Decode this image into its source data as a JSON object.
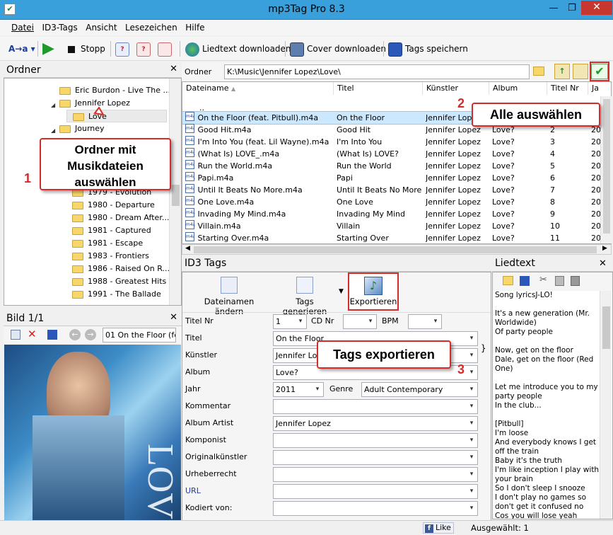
{
  "window": {
    "title": "mp3Tag Pro 8.3",
    "min": "—",
    "max": "❐",
    "close": "✕"
  },
  "menu": [
    "Datei",
    "ID3-Tags",
    "Ansicht",
    "Lesezeichen",
    "Hilfe"
  ],
  "toolbar": {
    "case_label": "A→a",
    "stop_label": "Stopp",
    "lyrics_label": "Liedtext downloaden",
    "cover_label": "Cover downloaden",
    "save_label": "Tags speichern"
  },
  "folder_panel": {
    "title": "Ordner",
    "close": "✕",
    "items": [
      "Eric Burdon - Live The ...",
      "Jennifer Lopez",
      "Love",
      "Journey",
      "1979 - Evolution",
      "1980 - Departure",
      "1980 - Dream After...",
      "1981 - Captured",
      "1981 - Escape",
      "1983 - Frontiers",
      "1986 - Raised On R...",
      "1988 - Greatest Hits",
      "1991 - The Ballade"
    ]
  },
  "image_panel": {
    "title": "Bild 1/1",
    "close": "✕",
    "filename": "01 On the Floor (fea",
    "cover_text": "LOVE?"
  },
  "file_panel": {
    "path_label": "Ordner",
    "path_value": "K:\\Music\\Jennifer Lopez\\Love\\",
    "columns": [
      "Dateiname",
      "Titel",
      "Künstler",
      "Album",
      "Titel Nr",
      "Ja"
    ],
    "parent": "..",
    "rows": [
      {
        "file": "01 On the Floor (feat. Pitbull).m4a",
        "title": "On the Floor",
        "artist": "Jennifer Lopez",
        "album": "Love?",
        "nr": "1",
        "year": "20"
      },
      {
        "file": "02 Good Hit.m4a",
        "title": "Good Hit",
        "artist": "Jennifer Lopez",
        "album": "Love?",
        "nr": "2",
        "year": "20"
      },
      {
        "file": "03 I'm Into You (feat. Lil Wayne).m4a",
        "title": "I'm Into You",
        "artist": "Jennifer Lopez",
        "album": "Love?",
        "nr": "3",
        "year": "20"
      },
      {
        "file": "04 (What Is) LOVE_.m4a",
        "title": "(What Is) LOVE?",
        "artist": "Jennifer Lopez",
        "album": "Love?",
        "nr": "4",
        "year": "20"
      },
      {
        "file": "05 Run the World.m4a",
        "title": "Run the World",
        "artist": "Jennifer Lopez",
        "album": "Love?",
        "nr": "5",
        "year": "20"
      },
      {
        "file": "06 Papi.m4a",
        "title": "Papi",
        "artist": "Jennifer Lopez",
        "album": "Love?",
        "nr": "6",
        "year": "20"
      },
      {
        "file": "07 Until It Beats No More.m4a",
        "title": "Until It Beats No More",
        "artist": "Jennifer Lopez",
        "album": "Love?",
        "nr": "7",
        "year": "20"
      },
      {
        "file": "08 One Love.m4a",
        "title": "One Love",
        "artist": "Jennifer Lopez",
        "album": "Love?",
        "nr": "8",
        "year": "20"
      },
      {
        "file": "09 Invading My Mind.m4a",
        "title": "Invading My Mind",
        "artist": "Jennifer Lopez",
        "album": "Love?",
        "nr": "9",
        "year": "20"
      },
      {
        "file": "10 Villain.m4a",
        "title": "Villain",
        "artist": "Jennifer Lopez",
        "album": "Love?",
        "nr": "10",
        "year": "20"
      },
      {
        "file": "11 Starting Over.m4a",
        "title": "Starting Over",
        "artist": "Jennifer Lopez",
        "album": "Love?",
        "nr": "11",
        "year": "20"
      }
    ]
  },
  "id3_panel": {
    "title": "ID3 Tags",
    "btn_rename": "Dateinamen ändern",
    "btn_generate": "Tags generieren",
    "btn_export": "Exportieren",
    "fields": {
      "track_label": "Titel Nr",
      "track_value": "1",
      "cd_label": "CD Nr",
      "cd_value": "",
      "bpm_label": "BPM",
      "bpm_value": "",
      "title_label": "Titel",
      "title_value": "On the Floor",
      "artist_label": "Künstler",
      "artist_value": "Jennifer Lop",
      "album_label": "Album",
      "album_value": "Love?",
      "year_label": "Jahr",
      "year_value": "2011",
      "genre_label": "Genre",
      "genre_value": "Adult Contemporary",
      "comment_label": "Kommentar",
      "comment_value": "",
      "albumartist_label": "Album Artist",
      "albumartist_value": "Jennifer Lopez",
      "composer_label": "Komponist",
      "composer_value": "",
      "origartist_label": "Originalkünstler",
      "origartist_value": "",
      "copyright_label": "Urheberrecht",
      "copyright_value": "",
      "url_label": "URL",
      "url_value": "",
      "encoded_label": "Kodiert von:",
      "encoded_value": ""
    },
    "brace": "}"
  },
  "lyrics_panel": {
    "title": "Liedtext",
    "close": "✕",
    "text": "Song lyricsJ-LO!\n\nIt's a new generation (Mr. Worldwide)\nOf party people\n\nNow, get on the floor\nDale, get on the floor (Red One)\n\nLet me introduce you to my party people\nIn the club...\n\n[Pitbull]\nI'm loose\nAnd everybody knows I get off the train\nBaby it's the truth\nI'm like inception I play with your brain\nSo I don't sleep I snooze\nI don't play no games so don't get it confused no\nCos you will lose yeah"
  },
  "status": {
    "like": "Like",
    "selected": "Ausgewählt: 1"
  },
  "callouts": {
    "c1": "Ordner mit Musikdateien auswählen",
    "c1_num": "1",
    "c2": "Alle auswählen",
    "c2_num": "2",
    "c3": "Tags exportieren",
    "c3_num": "3"
  },
  "colors": {
    "accent": "#d42b2b",
    "selection": "#cce8ff",
    "titlebar": "#3aa0dc"
  }
}
